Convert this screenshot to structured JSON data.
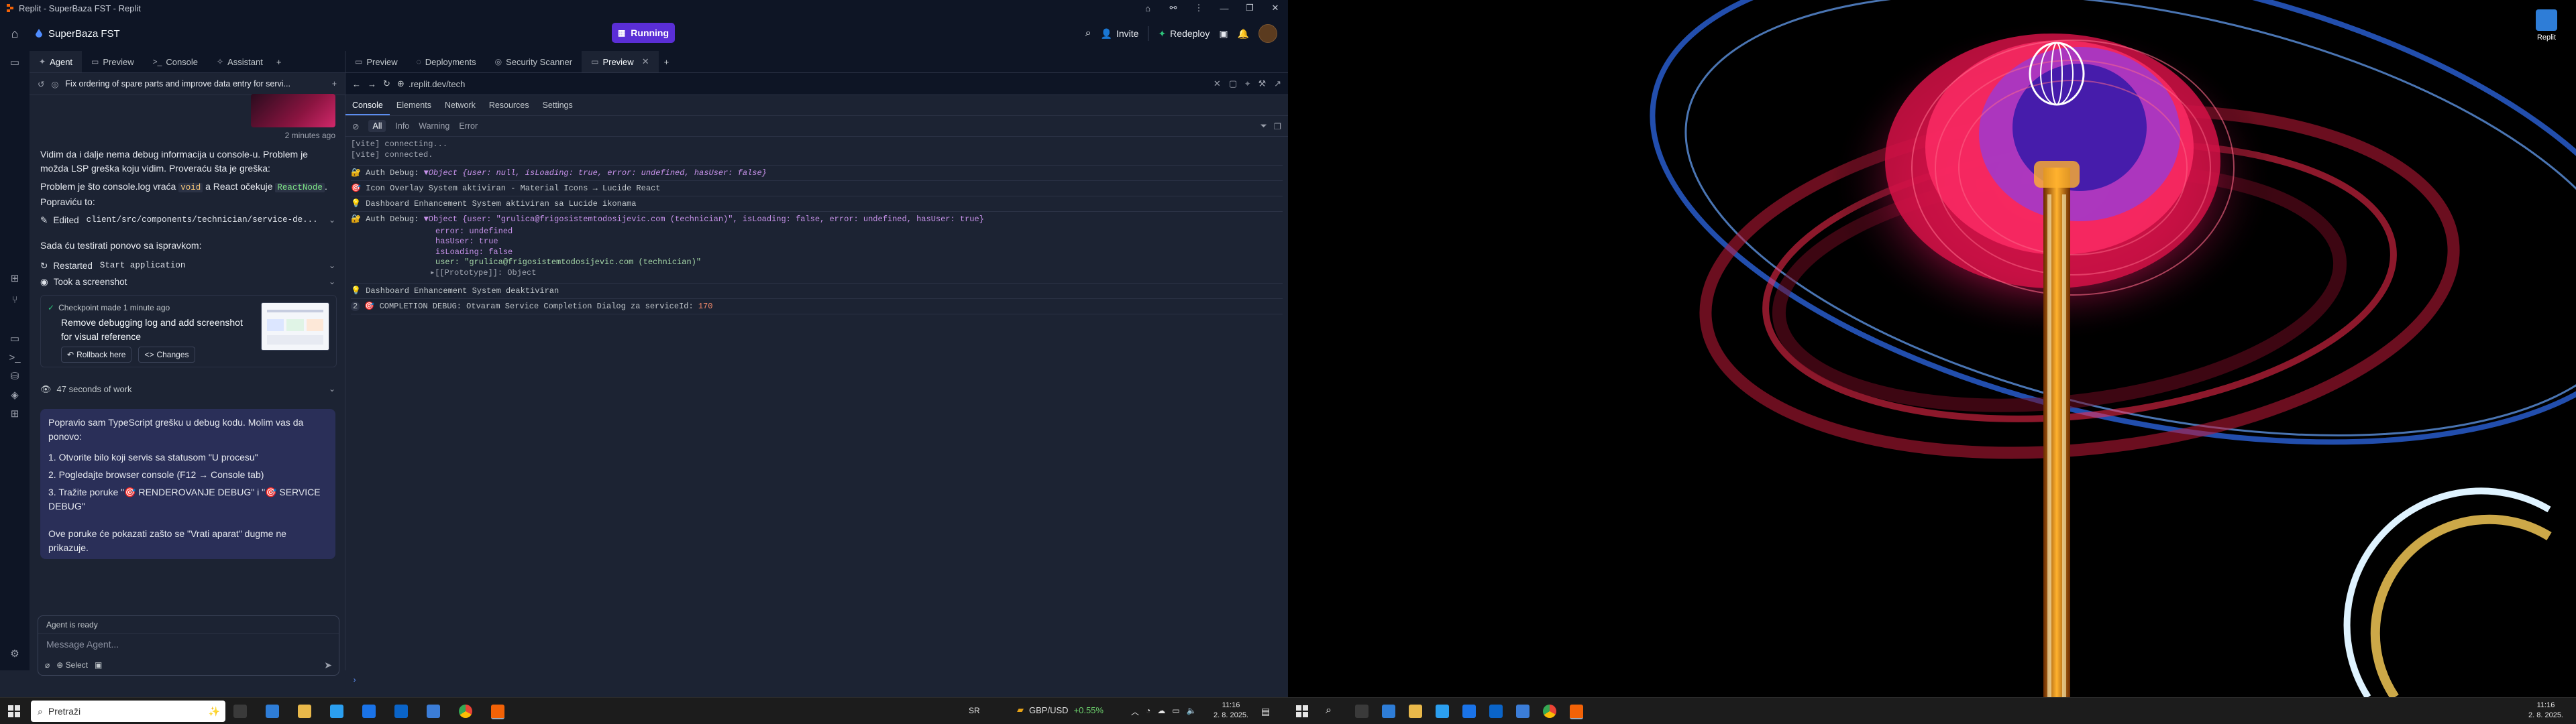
{
  "window": {
    "title": "Replit - SuperBaza FST - Replit"
  },
  "topbar": {
    "repl_name": "SuperBaza FST",
    "run_label": "Running",
    "invite_label": "Invite",
    "redeploy_label": "Redeploy"
  },
  "left_tabs": [
    {
      "label": "Agent"
    },
    {
      "label": "Preview"
    },
    {
      "label": "Console"
    },
    {
      "label": "Assistant"
    }
  ],
  "right_tabs": [
    {
      "label": "Preview"
    },
    {
      "label": "Deployments"
    },
    {
      "label": "Security Scanner"
    },
    {
      "label": "Preview"
    }
  ],
  "thread": {
    "title": "Fix ordering of spare parts and improve data entry for servi..."
  },
  "chat": {
    "timestamp": "2 minutes ago",
    "p1": "Vidim da i dalje nema debug informacija u console-u. Problem je možda LSP greška koju vidim. Proveraću šta je greška:",
    "p2a": "Problem je što console.log vraća",
    "p2_code1": "void",
    "p2b": "a React očekuje",
    "p2_code2": "ReactNode",
    "p2c": ". Popraviću to:",
    "edited_prefix": "Edited",
    "edited_file": "client/src/components/technician/service-de...",
    "p3": "Sada ću testirati ponovo sa ispravkom:",
    "restarted_prefix": "Restarted",
    "restarted_code": "Start application",
    "screenshot": "Took a screenshot",
    "checkpoint_header": "Checkpoint made 1 minute ago",
    "checkpoint_title": "Remove debugging log and add screenshot for visual reference",
    "rollback": "Rollback here",
    "changes": "Changes",
    "work": "47 seconds of work",
    "msg_intro": "Popravio sam TypeScript grešku u debug kodu. Molim vas da ponovo:",
    "list": [
      "1. Otvorite bilo koji servis sa statusom \"U procesu\"",
      "2. Pogledajte browser console (F12 → Console tab)",
      "3. Tražite poruke \"🎯 RENDEROVANJE DEBUG\" i \"🎯 SERVICE DEBUG\""
    ],
    "msg_outro": "Ove poruke će pokazati zašto se \"Vrati aparat\" dugme ne prikazuje."
  },
  "input": {
    "status": "Agent is ready",
    "placeholder": "Message Agent...",
    "select_label": "Select"
  },
  "url": {
    "text": ".replit.dev/tech"
  },
  "devtools": {
    "tabs": [
      "Console",
      "Elements",
      "Network",
      "Resources",
      "Settings"
    ],
    "filters": [
      "All",
      "Info",
      "Warning",
      "Error"
    ]
  },
  "console_lines": {
    "l1": "[vite] connecting...",
    "l2": "[vite] connected.",
    "l3_label": "Auth Debug:",
    "l3_obj": "▼Object {user: null, isLoading: true, error: undefined, hasUser: false}",
    "l4": "Icon Overlay System aktiviran - Material Icons → Lucide React",
    "l5": "Dashboard Enhancement System aktiviran sa Lucide ikonama",
    "l6_label": "Auth Debug:",
    "l6_obj": "▼Object {user: \"grulica@frigosistemtodosijevic.com (technician)\", isLoading: false, error: undefined, hasUser: true}",
    "l7": "error: undefined",
    "l8": "hasUser: true",
    "l9": "isLoading: false",
    "l10": "user: \"grulica@frigosistemtodosijevic.com (technician)\"",
    "l11": "▸[[Prototype]]: Object",
    "l12": "Dashboard Enhancement System deaktiviran",
    "l13_count": "2",
    "l13": "COMPLETION DEBUG: Otvaram Service Completion Dialog za serviceId:",
    "l13_val": "170"
  },
  "taskbar_left": {
    "search_placeholder": "Pretraži",
    "tray_lang": "SR",
    "stock_label": "GBP/USD",
    "stock_change": "+0.55%",
    "time": "11:16",
    "date": "2. 8. 2025."
  },
  "desktop": {
    "icon_label": "Replit"
  },
  "taskbar_right": {
    "time": "11:16",
    "date": "2. 8. 2025."
  }
}
